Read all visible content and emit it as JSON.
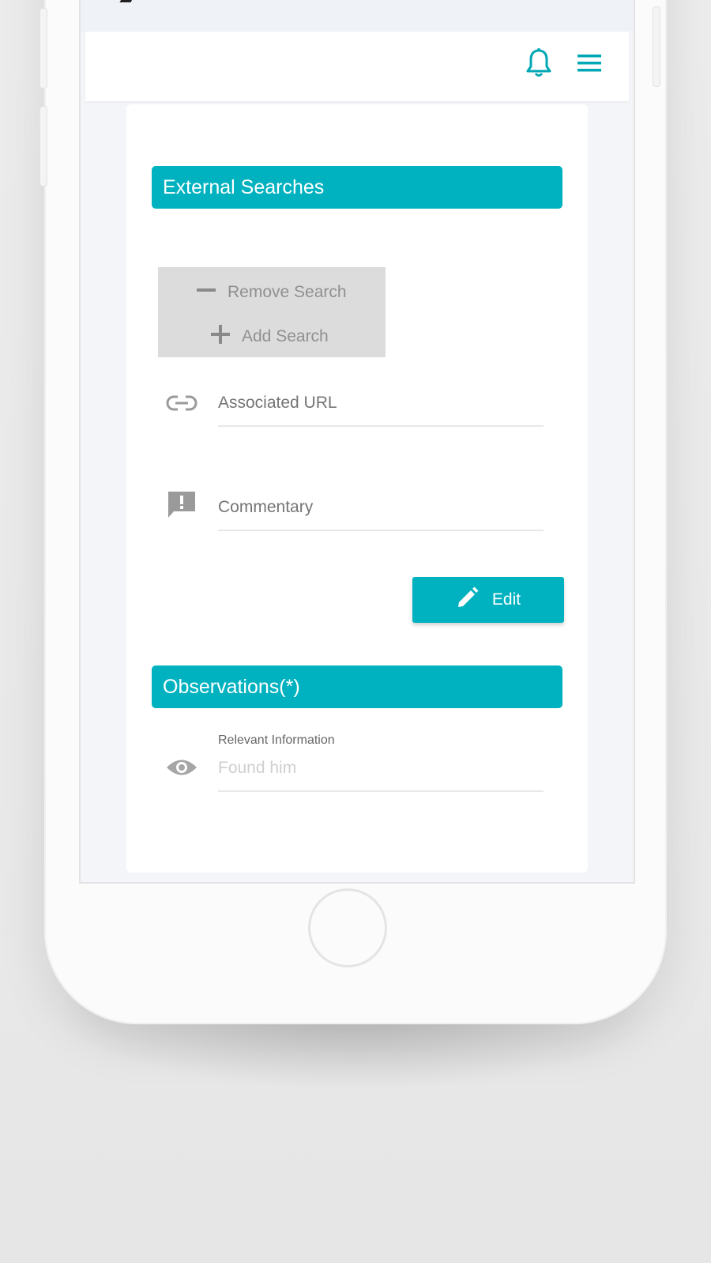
{
  "sections": {
    "external_searches": "External Searches",
    "observations": "Observations(*)"
  },
  "search_actions": {
    "remove": "Remove Search",
    "add": "Add Search"
  },
  "fields": {
    "associated_url": {
      "placeholder": "Associated URL",
      "icon": "link-icon"
    },
    "commentary": {
      "placeholder": "Commentary",
      "icon": "comment-alert-icon"
    },
    "relevant_information": {
      "label": "Relevant Information",
      "value": "Found him",
      "icon": "eye-icon"
    }
  },
  "buttons": {
    "edit": "Edit"
  },
  "appbar": {
    "icons": [
      "bell-icon",
      "menu-icon"
    ]
  },
  "colors": {
    "accent": "#00b2bf",
    "search_box": "#dcdcdc"
  }
}
